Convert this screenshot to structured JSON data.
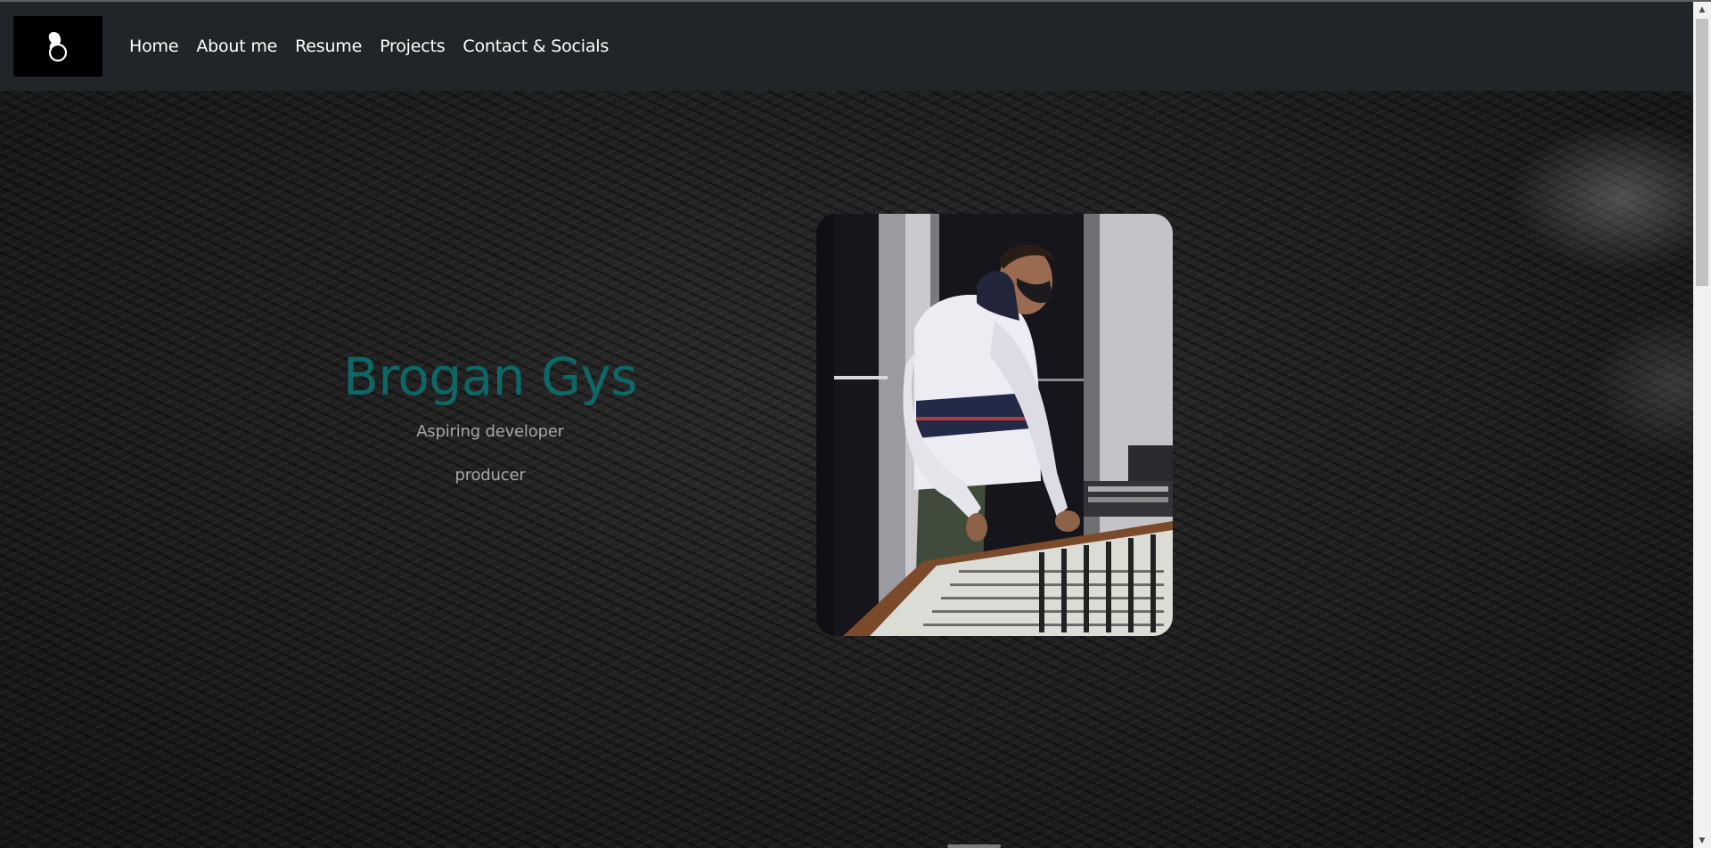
{
  "navbar": {
    "logo_icon": "person-silhouette-logo",
    "links": [
      "Home",
      "About me",
      "Resume",
      "Projects",
      "Contact & Socials"
    ]
  },
  "hero": {
    "name": "Brogan Gys",
    "taglines": [
      "Aspiring developer",
      "producer"
    ],
    "photo": "photo-producer-at-mixing-console"
  },
  "colors": {
    "navbar_bg": "#212529",
    "name_accent": "#0e6767",
    "tagline": "#a6a6a6"
  }
}
